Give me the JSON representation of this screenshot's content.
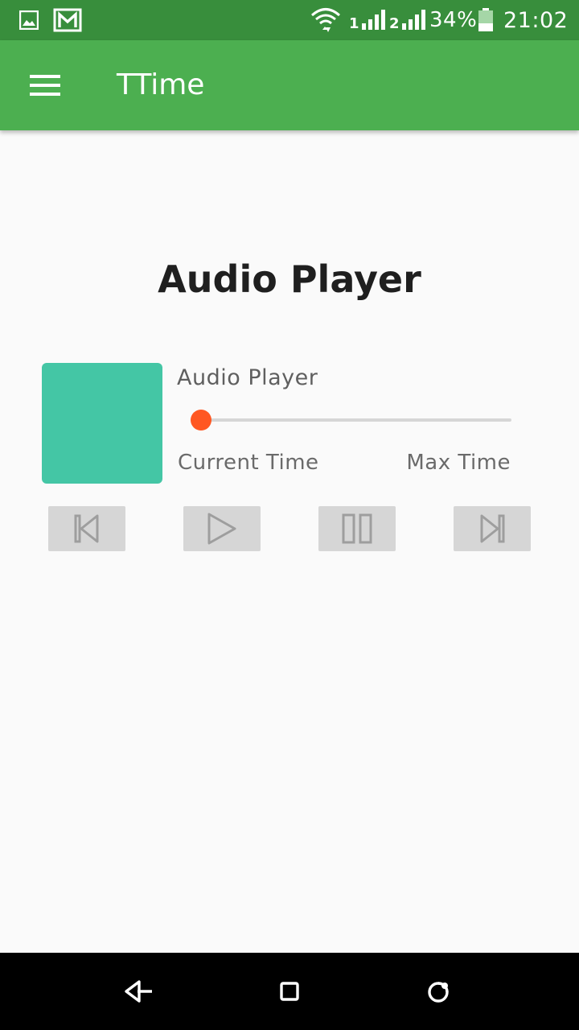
{
  "status_bar": {
    "battery_percent": "34%",
    "time": "21:02",
    "sim1_label": "1",
    "sim2_label": "2",
    "icons": [
      "image-icon",
      "gmail-icon",
      "wifi-icon",
      "signal-sim1-icon",
      "signal-sim2-icon",
      "battery-icon"
    ],
    "battery_level": 0.34
  },
  "app_bar": {
    "title": "TTime",
    "menu_icon": "hamburger-menu-icon",
    "color": "#4caf50"
  },
  "player": {
    "heading": "Audio Player",
    "track_title": "Audio Player",
    "current_time_label": "Current Time",
    "max_time_label": "Max Time",
    "progress": 0.0,
    "artwork_color": "#44c6a5",
    "accent_color": "#ff5722",
    "controls": [
      {
        "name": "previous-button",
        "icon": "skip-previous-icon"
      },
      {
        "name": "play-button",
        "icon": "play-icon"
      },
      {
        "name": "pause-button",
        "icon": "pause-icon"
      },
      {
        "name": "next-button",
        "icon": "skip-next-icon"
      }
    ]
  },
  "nav_bar": {
    "icons": [
      "back-icon",
      "home-icon",
      "recents-icon"
    ]
  }
}
